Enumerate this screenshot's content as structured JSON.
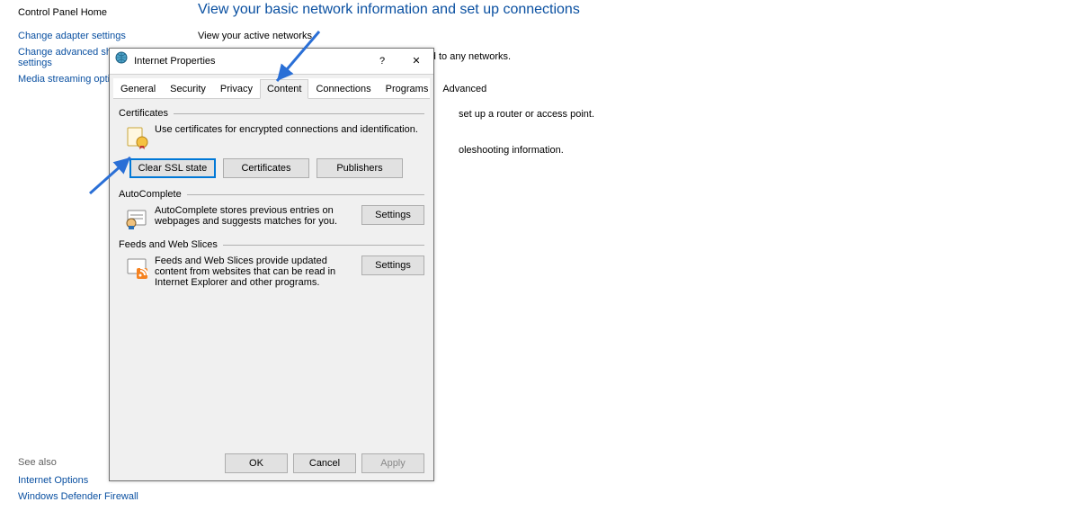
{
  "sidebar": {
    "home": "Control Panel Home",
    "links": [
      "Change adapter settings",
      "Change advanced sharing settings",
      "Media streaming options"
    ],
    "see_also": "See also",
    "bottom_links": [
      "Internet Options",
      "Windows Defender Firewall"
    ]
  },
  "main": {
    "title": "View your basic network information and set up connections",
    "sub": "View your active networks",
    "not_connected": "You are currently not connected to any networks.",
    "frag1": "set up a router or access point.",
    "frag2": "oleshooting information."
  },
  "dialog": {
    "title": "Internet Properties",
    "help": "?",
    "close": "✕",
    "tabs": [
      "General",
      "Security",
      "Privacy",
      "Content",
      "Connections",
      "Programs",
      "Advanced"
    ],
    "active_tab": 3,
    "certificates": {
      "label": "Certificates",
      "desc": "Use certificates for encrypted connections and identification.",
      "clear": "Clear SSL state",
      "certs": "Certificates",
      "pubs": "Publishers"
    },
    "autocomplete": {
      "label": "AutoComplete",
      "desc": "AutoComplete stores previous entries on webpages and suggests matches for you.",
      "btn": "Settings"
    },
    "feeds": {
      "label": "Feeds and Web Slices",
      "desc": "Feeds and Web Slices provide updated content from websites that can be read in Internet Explorer and other programs.",
      "btn": "Settings"
    },
    "footer": {
      "ok": "OK",
      "cancel": "Cancel",
      "apply": "Apply"
    }
  }
}
